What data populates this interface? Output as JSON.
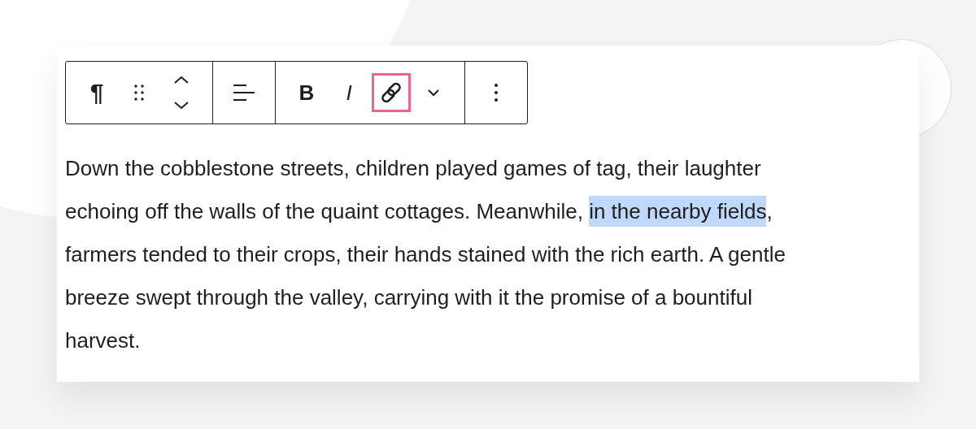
{
  "toolbar": {
    "groups": [
      {
        "buttons": [
          {
            "kind": "paragraph",
            "label": "¶"
          },
          {
            "kind": "drag"
          },
          {
            "kind": "move"
          }
        ]
      },
      {
        "buttons": [
          {
            "kind": "align"
          }
        ]
      },
      {
        "buttons": [
          {
            "kind": "bold",
            "label": "B"
          },
          {
            "kind": "italic",
            "label": "I"
          },
          {
            "kind": "link",
            "highlighted": true
          },
          {
            "kind": "chevron"
          }
        ]
      },
      {
        "buttons": [
          {
            "kind": "more"
          }
        ]
      }
    ]
  },
  "paragraph": {
    "lines": [
      {
        "segments": [
          {
            "text": "Down the cobblestone streets, children played games of tag, their laughter",
            "selected": false
          }
        ]
      },
      {
        "segments": [
          {
            "text": "echoing off the walls of the quaint cottages. Meanwhile, ",
            "selected": false
          },
          {
            "text": "in the nearby fields",
            "selected": true
          },
          {
            "text": ",",
            "selected": false
          }
        ]
      },
      {
        "segments": [
          {
            "text": "farmers tended to their crops, their hands stained with the rich earth. A gentle",
            "selected": false
          }
        ]
      },
      {
        "segments": [
          {
            "text": "breeze swept through the valley, carrying with it the promise of a bountiful",
            "selected": false
          }
        ]
      },
      {
        "segments": [
          {
            "text": "harvest.",
            "selected": false
          }
        ]
      }
    ]
  }
}
